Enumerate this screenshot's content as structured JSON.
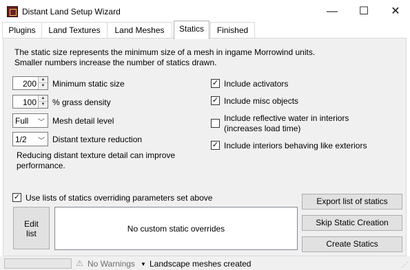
{
  "window": {
    "title": "Distant Land Setup Wizard",
    "minimize": "—",
    "maximize": "☐",
    "close": "✕"
  },
  "tabs": [
    {
      "label": "Plugins",
      "active": false
    },
    {
      "label": "Land Textures",
      "active": false
    },
    {
      "label": "Land Meshes",
      "active": false
    },
    {
      "label": "Statics",
      "active": true
    },
    {
      "label": "Finished",
      "active": false
    }
  ],
  "statics": {
    "description_line1": "The static size represents the minimum size of a mesh in ingame Morrowind units.",
    "description_line2": "Smaller numbers increase the number of statics drawn.",
    "min_static_size": {
      "value": "200",
      "label": "Minimum static size"
    },
    "grass_density": {
      "value": "100",
      "label": "% grass density"
    },
    "mesh_detail": {
      "value": "Full",
      "label": "Mesh detail level"
    },
    "texture_reduction": {
      "value": "1/2",
      "label": "Distant texture reduction"
    },
    "reduction_note_line1": "Reducing distant texture detail can improve",
    "reduction_note_line2": "performance.",
    "include_activators": {
      "label": "Include activators",
      "checked": true
    },
    "include_misc": {
      "label": "Include misc objects",
      "checked": true
    },
    "include_reflective_line1": "Include reflective water in interiors",
    "include_reflective_line2": "(increases load time)",
    "include_reflective_checked": false,
    "include_interiors": {
      "label": "Include interiors behaving like exteriors",
      "checked": true
    },
    "use_lists": {
      "label": "Use lists of statics overriding parameters set above",
      "checked": true
    },
    "edit_list_line1": "Edit",
    "edit_list_line2": "list",
    "overrides_empty": "No custom static overrides",
    "export_button": "Export list of statics",
    "skip_button": "Skip Static Creation",
    "create_button": "Create Statics"
  },
  "status": {
    "warnings": "No Warnings",
    "message": "Landscape meshes created"
  },
  "icons": {
    "check": "✓",
    "spin_up": "▲",
    "spin_down": "▼",
    "dropdown": "﹀",
    "warning": "⚠",
    "status_arrow": "▼",
    "grip": "⋰"
  }
}
